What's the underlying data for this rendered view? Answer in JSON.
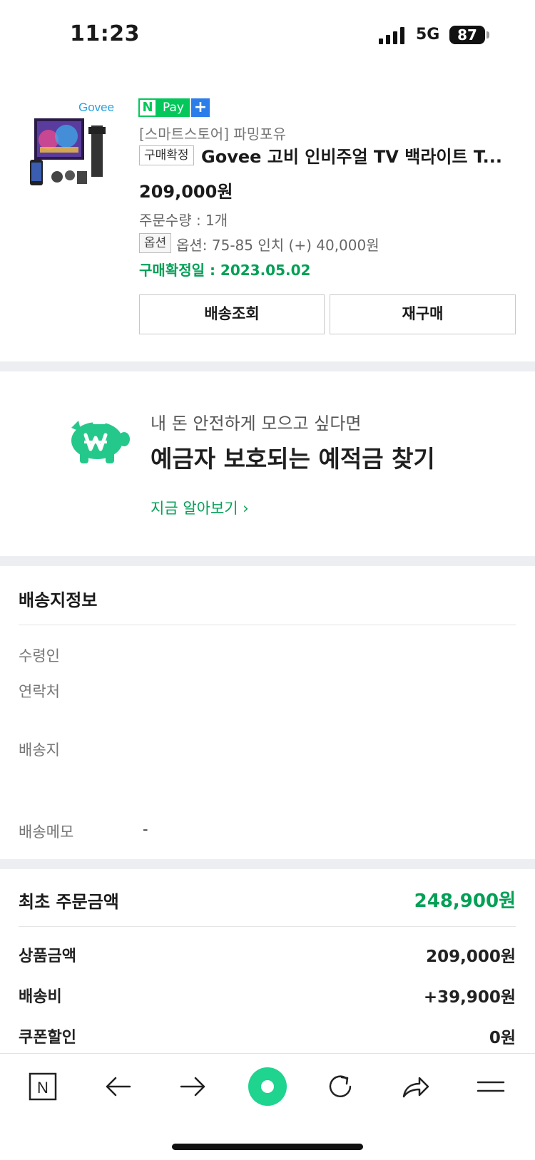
{
  "status_bar": {
    "time": "11:23",
    "network": "5G",
    "battery": "87"
  },
  "order": {
    "pay_badge": {
      "n": "N",
      "text": "Pay",
      "plus": "+"
    },
    "store": "[스마트스토어] 파밍포유",
    "confirm_tag": "구매확정",
    "product_title": "Govee 고비 인비주얼 TV 백라이트 T...",
    "price": "209,000원",
    "quantity": "주문수량 : 1개",
    "option_tag": "옵션",
    "option_text": "옵션: 75-85 인치 (+) 40,000원",
    "confirm_date": "구매확정일 : 2023.05.02",
    "buttons": {
      "track": "배송조회",
      "reorder": "재구매"
    },
    "thumb_brand": "Govee"
  },
  "promo": {
    "subtitle": "내 돈 안전하게 모으고 싶다면",
    "title": "예금자 보호되는 예적금 찾기",
    "link": "지금 알아보기 ›"
  },
  "shipping": {
    "title": "배송지정보",
    "recipient_label": "수령인",
    "contact_label": "연락처",
    "address_label": "배송지",
    "memo_label": "배송메모",
    "memo_value": "-"
  },
  "totals": {
    "title": "최초 주문금액",
    "total": "248,900원",
    "rows": [
      {
        "label": "상품금액",
        "value": "209,000원"
      },
      {
        "label": "배송비",
        "value": "+39,900원"
      },
      {
        "label": "쿠폰할인",
        "value": "0원"
      }
    ]
  },
  "toolbar": {
    "icons": [
      "naver-home-icon",
      "back-arrow-icon",
      "forward-arrow-icon",
      "green-dot-icon",
      "reload-icon",
      "share-icon",
      "menu-icon"
    ],
    "home_letter": "N"
  },
  "colors": {
    "accent": "#03c75a",
    "accent_text": "#03a056",
    "section_gap": "#eceef1"
  }
}
